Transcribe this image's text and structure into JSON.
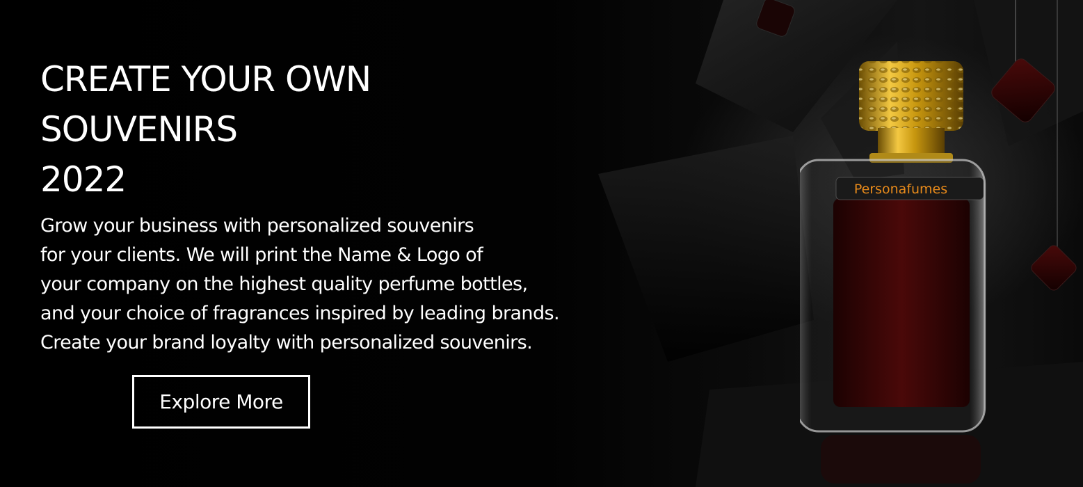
{
  "hero": {
    "headline": [
      "CREATE YOUR OWN",
      "SOUVENIRS",
      "2022"
    ],
    "body": [
      "Grow your business with personalized souvenirs",
      "for your clients. We will print the Name & Logo of",
      "your company on the highest quality perfume bottles,",
      "and your choice of fragrances inspired by leading brands.",
      "Create your brand loyalty with personalized souvenirs."
    ],
    "cta_label": "Explore More"
  },
  "product": {
    "bottle_label": "Personafumes",
    "cap_color": "#d4a514",
    "liquid_color": "#3a0606",
    "label_color": "#e88a1a"
  },
  "colors": {
    "background": "#000000",
    "text": "#ffffff"
  }
}
